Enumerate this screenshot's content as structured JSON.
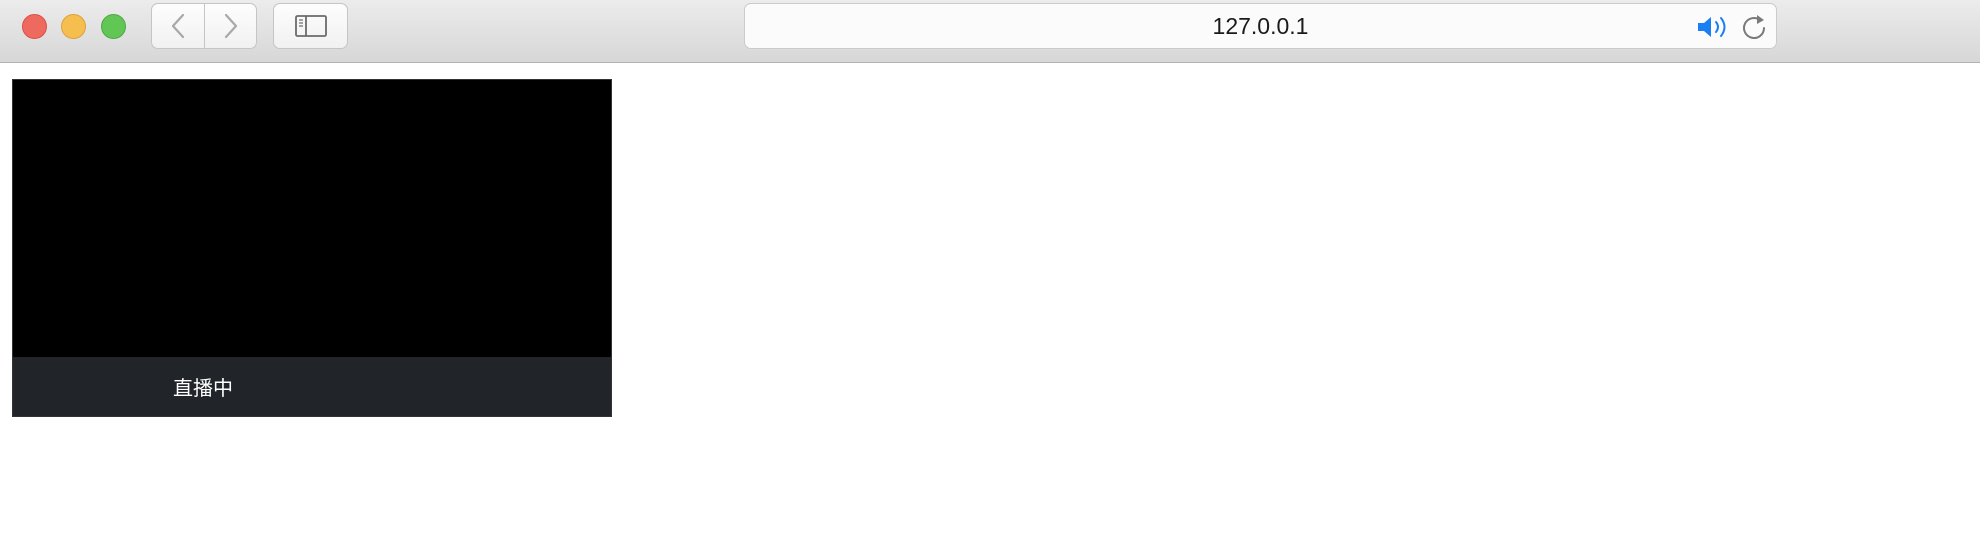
{
  "browser": {
    "url": "127.0.0.1",
    "icons": {
      "back": "chevron-left-icon",
      "forward": "chevron-right-icon",
      "sidebar": "sidebar-icon",
      "audio": "speaker-icon",
      "reload": "reload-icon"
    },
    "colors": {
      "close": "#ee6a5f",
      "minimize": "#f5be4f",
      "zoom": "#62c655",
      "audio_accent": "#1a7ff3"
    }
  },
  "player": {
    "status_label": "直播中",
    "status_bar_color": "#21252a"
  }
}
